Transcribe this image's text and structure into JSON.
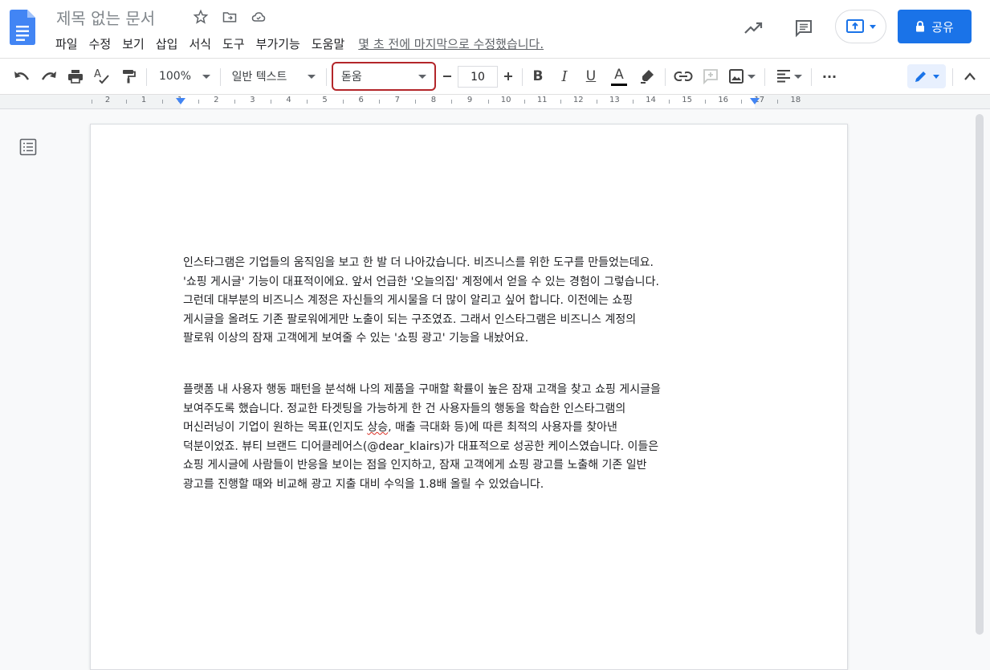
{
  "document": {
    "title": "제목 없는 문서",
    "last_edit": "몇 초 전에 마지막으로 수정했습니다."
  },
  "menu": [
    "파일",
    "수정",
    "보기",
    "삽입",
    "서식",
    "도구",
    "부가기능",
    "도움말"
  ],
  "header": {
    "share_label": "공유"
  },
  "toolbar": {
    "zoom": "100%",
    "style": "일반 텍스트",
    "font": "돋움",
    "font_size": "10",
    "bold_label": "B",
    "italic_label": "I",
    "underline_label": "U",
    "text_color_label": "A",
    "more_label": "···"
  },
  "ruler": {
    "numbers": [
      "2",
      "1",
      "1",
      "2",
      "3",
      "4",
      "5",
      "6",
      "7",
      "8",
      "9",
      "10",
      "11",
      "12",
      "13",
      "14",
      "15",
      "16",
      "17",
      "18"
    ]
  },
  "body": {
    "paragraph1": [
      "인스타그램은 기업들의 움직임을 보고 한 발 더 나아갔습니다. 비즈니스를 위한 도구를 만들었는데요.",
      "'쇼핑 게시글' 기능이 대표적이에요. 앞서 언급한 '오늘의집' 계정에서 얻을 수 있는 경험이 그렇습니다.",
      "그런데 대부분의 비즈니스 계정은 자신들의 게시물을 더 많이 알리고 싶어 합니다. 이전에는 쇼핑",
      "게시글을 올려도 기존 팔로워에게만 노출이 되는 구조였죠. 그래서 인스타그램은 비즈니스 계정의",
      "팔로워 이상의 잠재 고객에게 보여줄 수 있는 '쇼핑 광고' 기능을 내놨어요."
    ],
    "paragraph2": {
      "line1": "플랫폼 내 사용자 행동 패턴을 분석해 나의 제품을 구매할 확률이 높은 잠재 고객을 찾고 쇼핑 게시글을",
      "line2": "보여주도록 했습니다. 정교한 타겟팅을 가능하게 한 건 사용자들의 행동을 학습한 인스타그램의",
      "line3_pre": "머신러닝이 기업이 원하는 목표(인지도 ",
      "line3_err": "상승",
      "line3_post": ", 매출 극대화 등)에 따른 최적의 사용자를 찾아낸",
      "line4": "덕분이었죠. 뷰티 브랜드 디어클레어스(@dear_klairs)가 대표적으로 성공한 케이스였습니다. 이들은",
      "line5": "쇼핑 게시글에 사람들이 반응을 보이는 점을 인지하고, 잠재 고객에게 쇼핑 광고를 노출해 기존 일반",
      "line6": "광고를 진행할 때와 비교해 광고 지출 대비 수익을 1.8배 올릴 수 있었습니다."
    }
  },
  "colors": {
    "accent": "#1a73e8",
    "font_highlight_border": "#b3262a",
    "spell_error": "#d93025"
  }
}
